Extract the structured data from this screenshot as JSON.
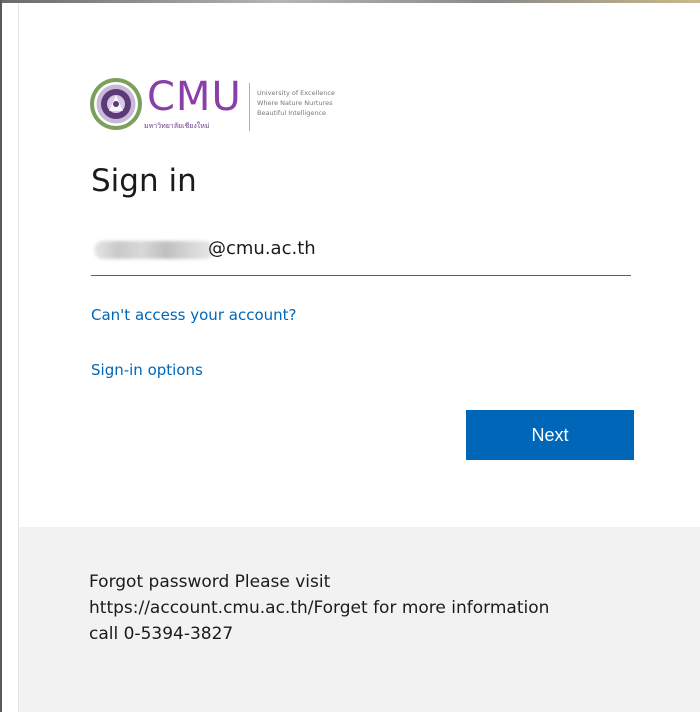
{
  "logo": {
    "wordmark": "CMU",
    "thai_name": "มหาวิทยาลัยเชียงใหม่",
    "tagline_lines": [
      "University of Excellence",
      "Where Nature Nurtures",
      "Beautiful Intelligence"
    ],
    "brand_color": "#8a3fa8",
    "emblem_icon": "cmu-seal-icon"
  },
  "signin": {
    "title": "Sign in",
    "email_domain": "@cmu.ac.th",
    "cant_access_link": "Can't access your account?",
    "signin_options_link": "Sign-in options",
    "next_button": "Next",
    "accent_color": "#0067b8"
  },
  "footer": {
    "text": "Forgot password Please visit https://account.cmu.ac.th/Forget for more information call 0-5394-3827"
  }
}
